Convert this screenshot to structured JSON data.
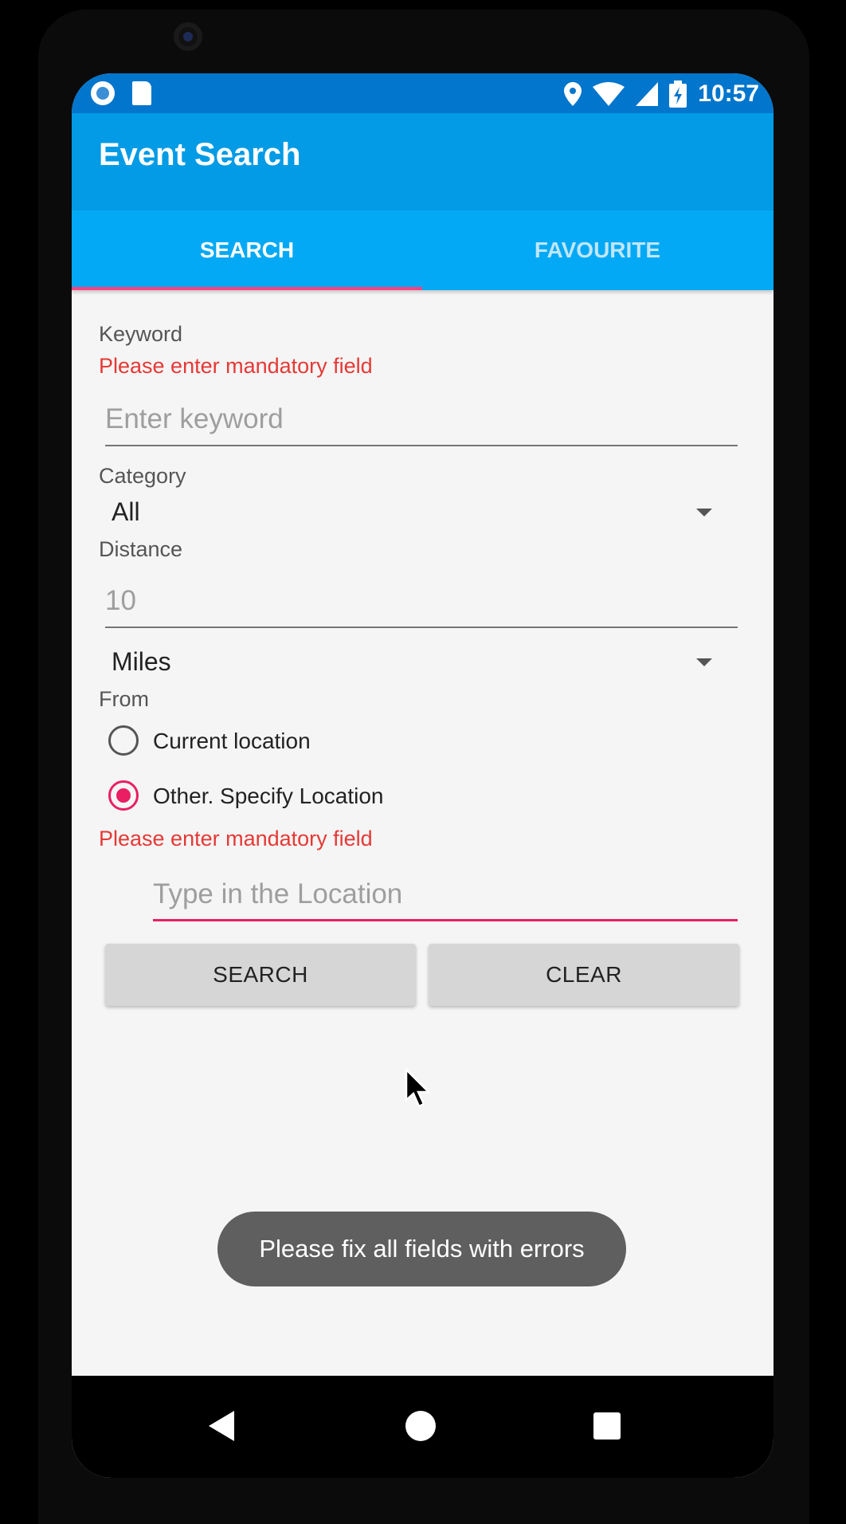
{
  "status_bar": {
    "time": "10:57",
    "icons": [
      "sync-icon",
      "sd-card-icon",
      "location-pin-icon",
      "wifi-icon",
      "cell-signal-icon",
      "battery-charging-icon"
    ]
  },
  "app_bar": {
    "title": "Event Search"
  },
  "tabs": [
    {
      "label": "SEARCH",
      "active": true
    },
    {
      "label": "FAVOURITE",
      "active": false
    }
  ],
  "form": {
    "keyword": {
      "label": "Keyword",
      "error": "Please enter mandatory field",
      "placeholder": "Enter keyword"
    },
    "category": {
      "label": "Category",
      "selected": "All"
    },
    "distance": {
      "label": "Distance",
      "placeholder": "10",
      "unit_selected": "Miles"
    },
    "from": {
      "label": "From",
      "options": [
        {
          "label": "Current location",
          "checked": false
        },
        {
          "label": "Other. Specify Location",
          "checked": true
        }
      ],
      "error": "Please enter mandatory field",
      "location_placeholder": "Type in the Location"
    },
    "buttons": {
      "search": "SEARCH",
      "clear": "CLEAR"
    }
  },
  "toast": "Please fix all fields with errors",
  "colors": {
    "status_bar": "#0275cc",
    "app_bar": "#039be5",
    "tab_bar": "#03a9f4",
    "accent": "#e91e63",
    "error": "#e53935"
  }
}
